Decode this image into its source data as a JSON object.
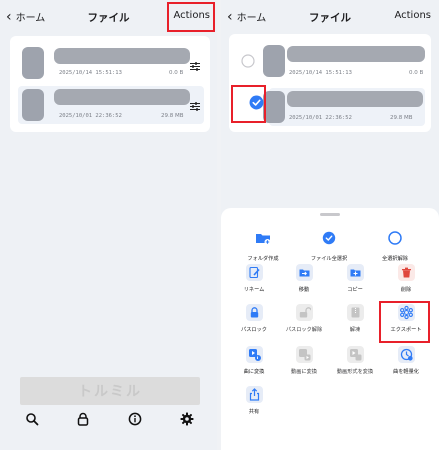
{
  "left": {
    "nav": {
      "back_label": "ホーム",
      "title": "ファイル",
      "actions_label": "Actions"
    },
    "files": [
      {
        "date": "2025/10/14 15:51:13",
        "size": "0.0 B"
      },
      {
        "date": "2025/10/01 22:36:52",
        "size": "29.8 MB"
      }
    ],
    "brand": "トルミル",
    "tabs": [
      "search-icon",
      "lock-icon",
      "info-icon",
      "gear-icon"
    ]
  },
  "right": {
    "nav": {
      "back_label": "ホーム",
      "title": "ファイル",
      "actions_label": "Actions"
    },
    "files": [
      {
        "date": "2025/10/14 15:51:13",
        "size": "0.0 B",
        "selected": false
      },
      {
        "date": "2025/10/01 22:36:52",
        "size": "29.8 MB",
        "selected": true
      }
    ]
  },
  "sheet": {
    "actions": [
      {
        "label": "フォルダ作成",
        "icon": "folder-plus-icon"
      },
      {
        "label": "ファイル全選択",
        "icon": "check-circle-icon"
      },
      {
        "label": "全選択解除",
        "icon": "circle-icon"
      },
      {
        "label": "リネーム",
        "icon": "rename-icon"
      },
      {
        "label": "移動",
        "icon": "move-icon"
      },
      {
        "label": "コピー",
        "icon": "copy-icon"
      },
      {
        "label": "削除",
        "icon": "trash-icon"
      },
      {
        "label": "パスロック",
        "icon": "lock-icon"
      },
      {
        "label": "パスロック解除",
        "icon": "unlock-icon"
      },
      {
        "label": "解凍",
        "icon": "unzip-icon"
      },
      {
        "label": "エクスポート",
        "icon": "export-icon"
      },
      {
        "label": "曲に変換",
        "icon": "convert-audio-icon"
      },
      {
        "label": "動画に変換",
        "icon": "convert-video-icon"
      },
      {
        "label": "動画形式を変換",
        "icon": "video-format-icon"
      },
      {
        "label": "曲を軽量化",
        "icon": "compress-audio-icon"
      },
      {
        "label": "共有",
        "icon": "share-icon"
      }
    ]
  },
  "colors": {
    "accent": "#2f7bf6",
    "highlight": "#e8202a",
    "delete": "#e0473d"
  }
}
